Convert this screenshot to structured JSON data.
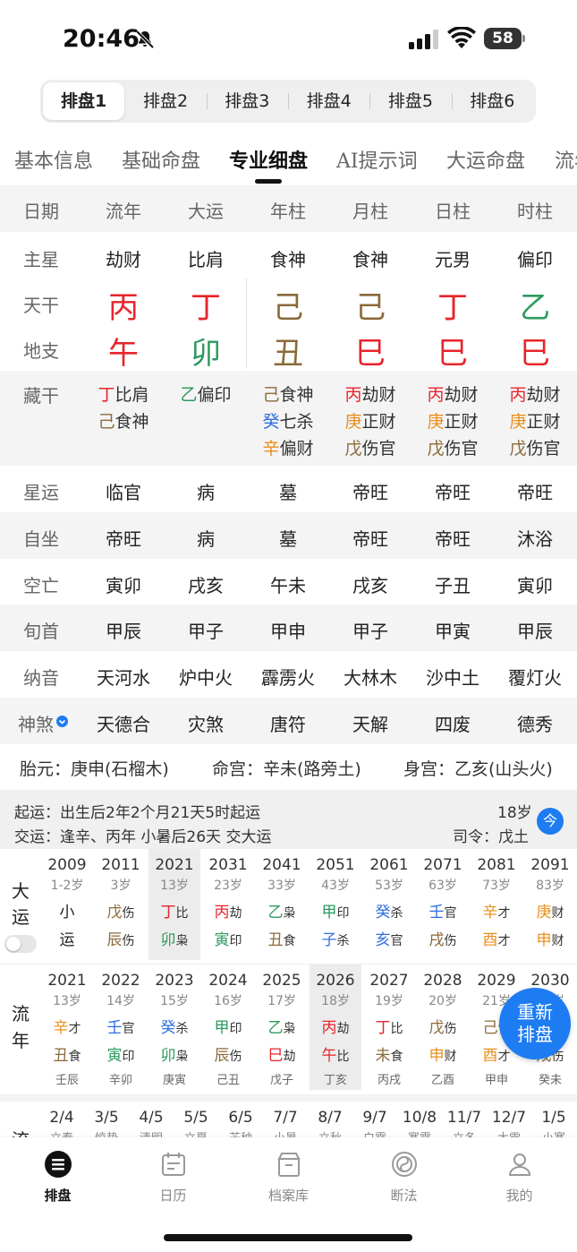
{
  "status_bar": {
    "time": "20:46",
    "battery": "58"
  },
  "chart_tabs": [
    "排盘1",
    "排盘2",
    "排盘3",
    "排盘4",
    "排盘5",
    "排盘6"
  ],
  "section_tabs": [
    "基本信息",
    "基础命盘",
    "专业细盘",
    "AI提示词",
    "大运命盘",
    "流年"
  ],
  "grid": {
    "header": [
      "日期",
      "流年",
      "大运",
      "年柱",
      "月柱",
      "日柱",
      "时柱"
    ],
    "zhuxing": {
      "label": "主星",
      "values": [
        "劫财",
        "比肩",
        "食神",
        "食神",
        "元男",
        "偏印"
      ]
    },
    "tiangan": {
      "label": "天干",
      "values": [
        "丙",
        "丁",
        "己",
        "己",
        "丁",
        "乙"
      ]
    },
    "dizhi": {
      "label": "地支",
      "values": [
        "午",
        "卯",
        "丑",
        "巳",
        "巳",
        "巳"
      ]
    },
    "canggan": {
      "label": "藏干",
      "cols": [
        [
          {
            "g": "丁",
            "s": "比肩"
          },
          {
            "g": "己",
            "s": "食神"
          }
        ],
        [
          {
            "g": "乙",
            "s": "偏印"
          }
        ],
        [
          {
            "g": "己",
            "s": "食神"
          },
          {
            "g": "癸",
            "s": "七杀"
          },
          {
            "g": "辛",
            "s": "偏财"
          }
        ],
        [
          {
            "g": "丙",
            "s": "劫财"
          },
          {
            "g": "庚",
            "s": "正财"
          },
          {
            "g": "戊",
            "s": "伤官"
          }
        ],
        [
          {
            "g": "丙",
            "s": "劫财"
          },
          {
            "g": "庚",
            "s": "正财"
          },
          {
            "g": "戊",
            "s": "伤官"
          }
        ],
        [
          {
            "g": "丙",
            "s": "劫财"
          },
          {
            "g": "庚",
            "s": "正财"
          },
          {
            "g": "戊",
            "s": "伤官"
          }
        ]
      ]
    },
    "xingyun": {
      "label": "星运",
      "values": [
        "临官",
        "病",
        "墓",
        "帝旺",
        "帝旺",
        "帝旺"
      ]
    },
    "zizuo": {
      "label": "自坐",
      "values": [
        "帝旺",
        "病",
        "墓",
        "帝旺",
        "帝旺",
        "沐浴"
      ]
    },
    "kongwang": {
      "label": "空亡",
      "values": [
        "寅卯",
        "戌亥",
        "午未",
        "戌亥",
        "子丑",
        "寅卯"
      ]
    },
    "xunshou": {
      "label": "旬首",
      "values": [
        "甲辰",
        "甲子",
        "甲申",
        "甲子",
        "甲寅",
        "甲辰"
      ]
    },
    "nayin": {
      "label": "纳音",
      "values": [
        "天河水",
        "炉中火",
        "霹雳火",
        "大林木",
        "沙中土",
        "覆灯火"
      ]
    },
    "shensha": {
      "label": "神煞",
      "values": [
        "天德合",
        "灾煞",
        "唐符",
        "天解",
        "四废",
        "德秀"
      ]
    }
  },
  "info": {
    "taiyuan": "胎元：庚申(石榴木)",
    "minggong": "命宫：辛未(路旁土)",
    "shengong": "身宫：乙亥(山头火)"
  },
  "qiyun": {
    "qiyun": "起运：出生后2年2个月21天5时起运",
    "jiaoyun": "交运：逢辛、丙年 小暑后26天 交大运",
    "age": "18岁",
    "siling": "司令：戊土",
    "today": "今"
  },
  "dayun": {
    "label_chars": [
      "大",
      "运"
    ],
    "cols": [
      {
        "year": "2009",
        "age": "1-2岁",
        "top": "小",
        "topS": "",
        "bot": "运",
        "botS": ""
      },
      {
        "year": "2011",
        "age": "3岁",
        "top": "戊",
        "topS": "伤",
        "bot": "辰",
        "botS": "伤"
      },
      {
        "year": "2021",
        "age": "13岁",
        "top": "丁",
        "topS": "比",
        "bot": "卯",
        "botS": "枭"
      },
      {
        "year": "2031",
        "age": "23岁",
        "top": "丙",
        "topS": "劫",
        "bot": "寅",
        "botS": "印"
      },
      {
        "year": "2041",
        "age": "33岁",
        "top": "乙",
        "topS": "枭",
        "bot": "丑",
        "botS": "食"
      },
      {
        "year": "2051",
        "age": "43岁",
        "top": "甲",
        "topS": "印",
        "bot": "子",
        "botS": "杀"
      },
      {
        "year": "2061",
        "age": "53岁",
        "top": "癸",
        "topS": "杀",
        "bot": "亥",
        "botS": "官"
      },
      {
        "year": "2071",
        "age": "63岁",
        "top": "壬",
        "topS": "官",
        "bot": "戌",
        "botS": "伤"
      },
      {
        "year": "2081",
        "age": "73岁",
        "top": "辛",
        "topS": "才",
        "bot": "酉",
        "botS": "才"
      },
      {
        "year": "2091",
        "age": "83岁",
        "top": "庚",
        "topS": "财",
        "bot": "申",
        "botS": "财"
      }
    ]
  },
  "liunian": {
    "label_chars": [
      "流",
      "年"
    ],
    "cols": [
      {
        "year": "2021",
        "age": "13岁",
        "top": "辛",
        "topS": "才",
        "bot": "丑",
        "botS": "食",
        "xs": "壬辰"
      },
      {
        "year": "2022",
        "age": "14岁",
        "top": "壬",
        "topS": "官",
        "bot": "寅",
        "botS": "印",
        "xs": "辛卯"
      },
      {
        "year": "2023",
        "age": "15岁",
        "top": "癸",
        "topS": "杀",
        "bot": "卯",
        "botS": "枭",
        "xs": "庚寅"
      },
      {
        "year": "2024",
        "age": "16岁",
        "top": "甲",
        "topS": "印",
        "bot": "辰",
        "botS": "伤",
        "xs": "己丑"
      },
      {
        "year": "2025",
        "age": "17岁",
        "top": "乙",
        "topS": "枭",
        "bot": "巳",
        "botS": "劫",
        "xs": "戊子"
      },
      {
        "year": "2026",
        "age": "18岁",
        "top": "丙",
        "topS": "劫",
        "bot": "午",
        "botS": "比",
        "xs": "丁亥"
      },
      {
        "year": "2027",
        "age": "19岁",
        "top": "丁",
        "topS": "比",
        "bot": "未",
        "botS": "食",
        "xs": "丙戌"
      },
      {
        "year": "2028",
        "age": "20岁",
        "top": "戊",
        "topS": "伤",
        "bot": "申",
        "botS": "财",
        "xs": "乙酉"
      },
      {
        "year": "2029",
        "age": "21岁",
        "top": "己",
        "topS": "食",
        "bot": "酉",
        "botS": "才",
        "xs": "甲申"
      },
      {
        "year": "2030",
        "age": "22岁",
        "top": "庚",
        "topS": "财",
        "bot": "戌",
        "botS": "伤",
        "xs": "癸未"
      }
    ],
    "reset_label": [
      "重新",
      "排盘"
    ]
  },
  "jieqi": {
    "label": "流",
    "cols": [
      {
        "d": "2/4",
        "n": "立春"
      },
      {
        "d": "3/5",
        "n": "惊蛰"
      },
      {
        "d": "4/5",
        "n": "清明"
      },
      {
        "d": "5/5",
        "n": "立夏"
      },
      {
        "d": "6/5",
        "n": "芒种"
      },
      {
        "d": "7/7",
        "n": "小暑"
      },
      {
        "d": "8/7",
        "n": "立秋"
      },
      {
        "d": "9/7",
        "n": "白露"
      },
      {
        "d": "10/8",
        "n": "寒露"
      },
      {
        "d": "11/7",
        "n": "立冬"
      },
      {
        "d": "12/7",
        "n": "大雪"
      },
      {
        "d": "1/5",
        "n": "小寒"
      }
    ]
  },
  "bottom_nav": [
    "排盘",
    "日历",
    "档案库",
    "断法",
    "我的"
  ],
  "colors": {
    "fire": "#e8242b",
    "earth": "#8b6a3a",
    "wood": "#2e9a5e",
    "water": "#2f6fe0",
    "metal": "#e8901c",
    "accent": "#1e7cf2"
  }
}
